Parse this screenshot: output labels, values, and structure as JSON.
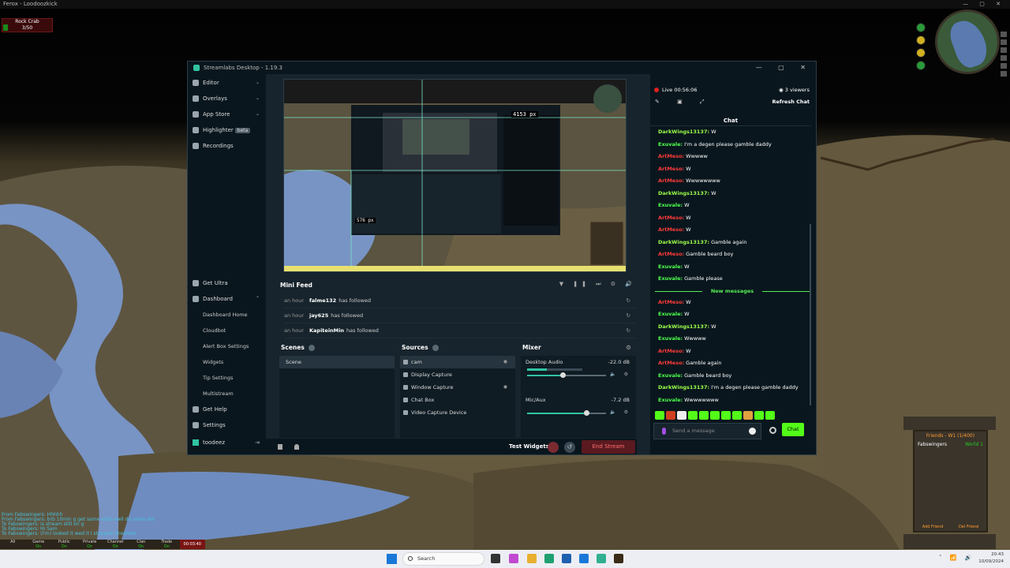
{
  "game": {
    "title": "Ferox - Loodoozkick",
    "npc_name": "Rock Crab",
    "npc_hp": "3/50",
    "chat_lines": [
      "From Fabswingers: Hhhhh",
      "From Fabswingers: brb 10min g get some stats well do some skil",
      "To Fabswingers: is stream still on g",
      "To Fabswingers: Hi Sam",
      "To Fabswingers: (I'm) looked it wed it I stopped streamloi"
    ],
    "chat_tabs": [
      "All",
      "Game",
      "Public",
      "Private",
      "Channel",
      "Clan",
      "Trade"
    ],
    "chat_tab_states": [
      "",
      "On",
      "On",
      "On",
      "On",
      "On",
      "On"
    ],
    "clock": "00:03:40",
    "friends_title": "Friends - W1 (1/400)",
    "friends": [
      {
        "name": "Fabswingers",
        "world": "World 1"
      }
    ],
    "add_friend": "Add Friend",
    "del_friend": "Del Friend"
  },
  "streamlabs": {
    "title": "Streamlabs Desktop - 1.19.3",
    "nav_top": [
      {
        "label": "Editor",
        "icon": "editor-icon",
        "chevron": true
      },
      {
        "label": "Overlays",
        "icon": "overlays-icon",
        "chevron": true
      },
      {
        "label": "App Store",
        "icon": "app-store-icon",
        "chevron": true
      },
      {
        "label": "Highlighter",
        "icon": "highlighter-icon",
        "badge": "beta"
      },
      {
        "label": "Recordings",
        "icon": "recordings-icon"
      }
    ],
    "nav_bottom": {
      "get_ultra": "Get Ultra",
      "dashboard": "Dashboard",
      "dashboard_sub": [
        "Dashboard Home",
        "Cloudbot",
        "Alert Box Settings",
        "Widgets",
        "Tip Settings",
        "Multistream"
      ],
      "get_help": "Get Help",
      "settings": "Settings"
    },
    "user": "toodeez",
    "preview_px1": "4153 px",
    "preview_px2": "576 px",
    "mini_feed": {
      "label": "Mini Feed",
      "rows": [
        {
          "time": "an hour",
          "name": "falme132",
          "action": "has followed"
        },
        {
          "time": "an hour",
          "name": "jay625",
          "action": "has followed"
        },
        {
          "time": "an hour",
          "name": "KapiteinMin",
          "action": "has followed"
        }
      ]
    },
    "scenes": {
      "label": "Scenes",
      "items": [
        "Scene"
      ]
    },
    "sources": {
      "label": "Sources",
      "items": [
        "cam",
        "Display Capture",
        "Window Capture",
        "Chat Box",
        "Video Capture Device"
      ]
    },
    "mixer": {
      "label": "Mixer",
      "channels": [
        {
          "name": "Desktop Audio",
          "db": "-22.0 dB",
          "level": 0.35,
          "volume": 0.45
        },
        {
          "name": "Mic/Aux",
          "db": "-7.2 dB",
          "level": 0.0,
          "volume": 0.75
        }
      ]
    },
    "footer": {
      "test_widgets": "Test Widgets",
      "end_stream": "End Stream"
    },
    "chat": {
      "live": "Live 00:56:06",
      "viewers": "3 viewers",
      "refresh": "Refresh Chat",
      "title": "Chat",
      "messages": [
        {
          "user": "DarkWings13137:",
          "text": "W",
          "color": "#9cff4a"
        },
        {
          "user": "Exuvale:",
          "text": "I'm a degen please gamble daddy",
          "color": "#4dff4d"
        },
        {
          "user": "ArtMeso:",
          "text": "Wwwww",
          "color": "#ff3b3b"
        },
        {
          "user": "ArtMeso:",
          "text": "W",
          "color": "#ff3b3b"
        },
        {
          "user": "ArtMeso:",
          "text": "Wwwwwwww",
          "color": "#ff3b3b"
        },
        {
          "user": "DarkWings13137:",
          "text": "W",
          "color": "#9cff4a"
        },
        {
          "user": "Exuvale:",
          "text": "W",
          "color": "#4dff4d"
        },
        {
          "user": "ArtMeso:",
          "text": "W",
          "color": "#ff3b3b"
        },
        {
          "user": "ArtMeso:",
          "text": "W",
          "color": "#ff3b3b"
        },
        {
          "user": "DarkWings13137:",
          "text": "Gamble again",
          "color": "#9cff4a"
        },
        {
          "user": "ArtMeso:",
          "text": "Gamble beard boy",
          "color": "#ff3b3b"
        },
        {
          "user": "Exuvale:",
          "text": "W",
          "color": "#4dff4d"
        },
        {
          "user": "Exuvale:",
          "text": "Gamble please",
          "color": "#4dff4d"
        }
      ],
      "new_messages_label": "New messages",
      "new_messages": [
        {
          "user": "ArtMeso:",
          "text": "W",
          "color": "#ff3b3b"
        },
        {
          "user": "Exuvale:",
          "text": "W",
          "color": "#4dff4d"
        },
        {
          "user": "DarkWings13137:",
          "text": "W",
          "color": "#9cff4a"
        },
        {
          "user": "Exuvale:",
          "text": "Wwwww",
          "color": "#4dff4d"
        },
        {
          "user": "ArtMeso:",
          "text": "W",
          "color": "#ff3b3b"
        },
        {
          "user": "ArtMeso:",
          "text": "Gamble again",
          "color": "#ff3b3b"
        },
        {
          "user": "Exuvale:",
          "text": "Gamble beard boy",
          "color": "#4dff4d"
        },
        {
          "user": "DarkWings13137:",
          "text": "I'm a degen please gamble daddy",
          "color": "#9cff4a"
        },
        {
          "user": "Exuvale:",
          "text": "Wwwwwwww",
          "color": "#4dff4d"
        }
      ],
      "placeholder": "Send a message",
      "send": "Chat"
    },
    "accent": "#31c3a2"
  },
  "taskbar": {
    "search": "Search",
    "time": "20:43",
    "date": "10/09/2024"
  }
}
